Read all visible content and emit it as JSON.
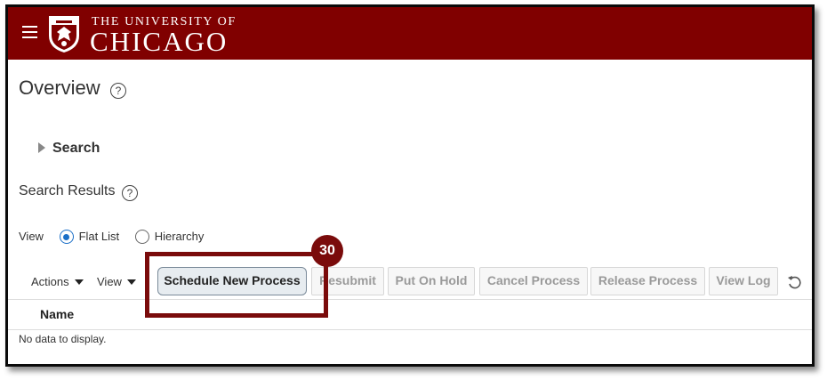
{
  "header": {
    "logo_top": "THE UNIVERSITY OF",
    "logo_bottom": "CHICAGO",
    "icons": {
      "menu": "hamburger-icon",
      "crest": "phoenix-crest-icon"
    },
    "bg_color": "#800000"
  },
  "page": {
    "title": "Overview",
    "help_icon": "question-circle-icon"
  },
  "search": {
    "label": "Search"
  },
  "search_results": {
    "title": "Search Results",
    "view_label": "View",
    "view_options": [
      {
        "label": "Flat List",
        "selected": true
      },
      {
        "label": "Hierarchy",
        "selected": false
      }
    ]
  },
  "toolbar": {
    "actions_label": "Actions",
    "view_label": "View",
    "buttons": [
      {
        "label": "Schedule New Process",
        "enabled": true
      },
      {
        "label": "Resubmit",
        "enabled": false
      },
      {
        "label": "Put On Hold",
        "enabled": false
      },
      {
        "label": "Cancel Process",
        "enabled": false
      },
      {
        "label": "Release Process",
        "enabled": false
      },
      {
        "label": "View Log",
        "enabled": false
      }
    ],
    "refresh_icon": "refresh-icon"
  },
  "table": {
    "columns": [
      "Name"
    ],
    "empty_text": "No data to display."
  },
  "callout": {
    "step": "30",
    "color": "#7a0b0b"
  }
}
